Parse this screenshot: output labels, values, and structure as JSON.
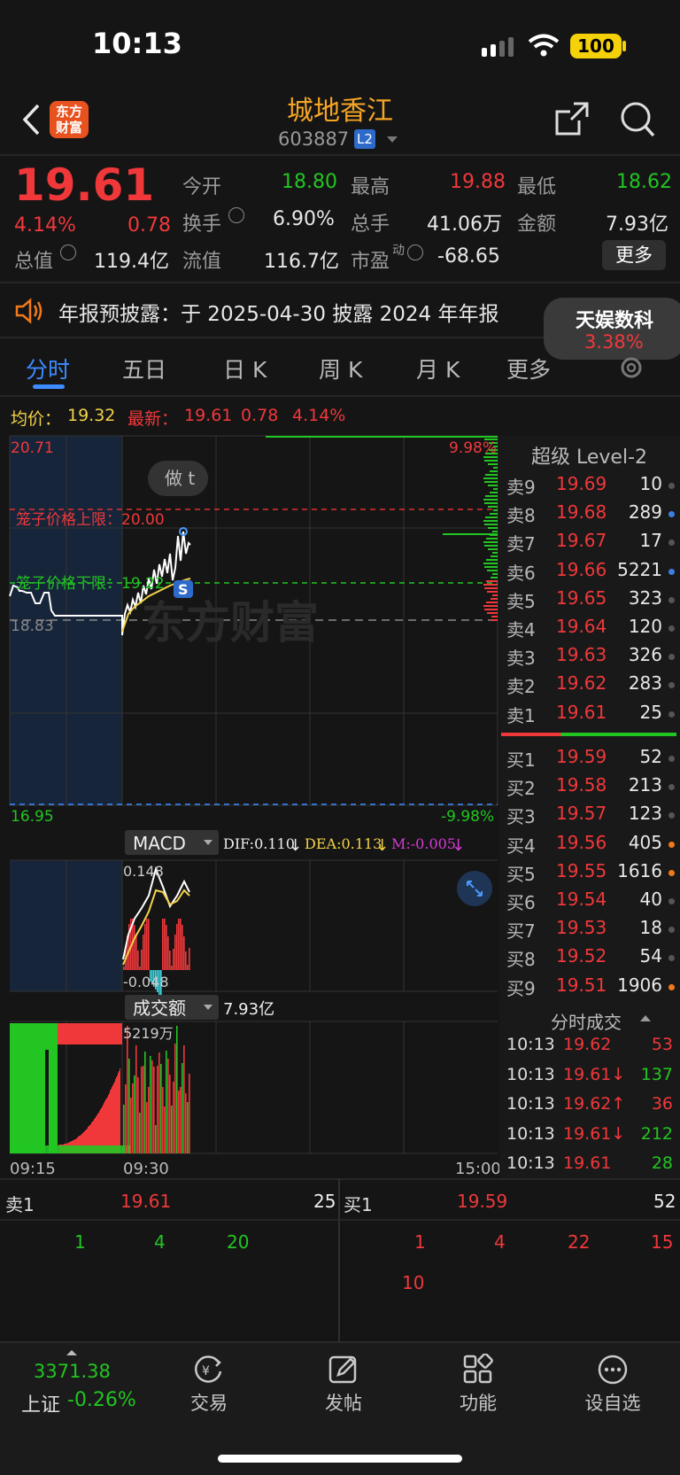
{
  "status_bar": {
    "time": "10:13",
    "battery": "100"
  },
  "header": {
    "logo": "东方财富",
    "title": "城地香江",
    "code": "603887",
    "level_badge": "L2"
  },
  "quote": {
    "price": "19.61",
    "change_pct": "4.14%",
    "change": "0.78",
    "open_label": "今开",
    "open": "18.80",
    "high_label": "最高",
    "high": "19.88",
    "low_label": "最低",
    "low": "18.62",
    "turnover_label": "换手",
    "turnover": "6.90%",
    "volume_label": "总手",
    "volume": "41.06万",
    "amount_label": "金额",
    "amount": "7.93亿",
    "mktcap_label": "总值",
    "mktcap": "119.4亿",
    "float_label": "流值",
    "float": "116.7亿",
    "pe_label": "市盈",
    "pe_sup": "动",
    "pe": "-68.65",
    "more_button": "更多"
  },
  "notice": {
    "text": "年报预披露：于 2025-04-30 披露 2024 年年报"
  },
  "hot_card": {
    "name": "天娱数科",
    "pct": "3.38%"
  },
  "tabs": [
    "分时",
    "五日",
    "日 K",
    "周 K",
    "月 K",
    "更多"
  ],
  "chart": {
    "avg_label": "均价：",
    "avg": "19.32",
    "latest_label": "最新：",
    "latest": "19.61",
    "latest_chg": "0.78",
    "latest_pct": "4.14%",
    "y_top": "20.71",
    "y_mid": "18.83",
    "y_bottom": "16.95",
    "pct_top": "9.98%",
    "pct_bottom": "-9.98%",
    "upper_limit": "笼子价格上限：20.00",
    "lower_limit": "笼子价格下限：19.22",
    "zuo_t": "做 t",
    "watermark": "东方财富",
    "macd_label": "MACD",
    "dif": "DIF:0.110",
    "dea": "DEA:0.113",
    "m": "M:-0.005",
    "macd_top": "0.148",
    "macd_bottom": "-0.048",
    "amount_label": "成交额",
    "amount_value": "7.93亿",
    "amount_peak": "5219万",
    "time_start": "09:15",
    "time_open": "09:30",
    "time_end": "15:00",
    "colors": {
      "up": "#f0383b",
      "down": "#22c522",
      "price_line": "#ffffff",
      "avg_line": "#f2d24a"
    }
  },
  "order_book": {
    "title": "超级 Level-2",
    "asks": [
      {
        "label": "卖9",
        "price": "19.69",
        "vol": "10",
        "dot": "#555555"
      },
      {
        "label": "卖8",
        "price": "19.68",
        "vol": "289",
        "dot": "#3d7fe0"
      },
      {
        "label": "卖7",
        "price": "19.67",
        "vol": "17",
        "dot": "#555555"
      },
      {
        "label": "卖6",
        "price": "19.66",
        "vol": "5221",
        "dot": "#3d7fe0"
      },
      {
        "label": "卖5",
        "price": "19.65",
        "vol": "323",
        "dot": "#555555"
      },
      {
        "label": "卖4",
        "price": "19.64",
        "vol": "120",
        "dot": "#555555"
      },
      {
        "label": "卖3",
        "price": "19.63",
        "vol": "326",
        "dot": "#555555"
      },
      {
        "label": "卖2",
        "price": "19.62",
        "vol": "283",
        "dot": "#555555"
      },
      {
        "label": "卖1",
        "price": "19.61",
        "vol": "25",
        "dot": "#555555"
      }
    ],
    "bids": [
      {
        "label": "买1",
        "price": "19.59",
        "vol": "52",
        "dot": "#555555"
      },
      {
        "label": "买2",
        "price": "19.58",
        "vol": "213",
        "dot": "#555555"
      },
      {
        "label": "买3",
        "price": "19.57",
        "vol": "123",
        "dot": "#555555"
      },
      {
        "label": "买4",
        "price": "19.56",
        "vol": "405",
        "dot": "#f07a1a"
      },
      {
        "label": "买5",
        "price": "19.55",
        "vol": "1616",
        "dot": "#f07a1a"
      },
      {
        "label": "买6",
        "price": "19.54",
        "vol": "40",
        "dot": "#555555"
      },
      {
        "label": "买7",
        "price": "19.53",
        "vol": "18",
        "dot": "#555555"
      },
      {
        "label": "买8",
        "price": "19.52",
        "vol": "54",
        "dot": "#555555"
      },
      {
        "label": "买9",
        "price": "19.51",
        "vol": "1906",
        "dot": "#f07a1a"
      }
    ]
  },
  "trades": {
    "title": "分时成交",
    "rows": [
      {
        "time": "10:13",
        "price": "19.62",
        "arrow": "",
        "vol": "53",
        "vcolor": "#f0383b"
      },
      {
        "time": "10:13",
        "price": "19.61",
        "arrow": "↓",
        "vol": "137",
        "vcolor": "#22c522"
      },
      {
        "time": "10:13",
        "price": "19.62",
        "arrow": "↑",
        "vol": "36",
        "vcolor": "#f0383b"
      },
      {
        "time": "10:13",
        "price": "19.61",
        "arrow": "↓",
        "vol": "212",
        "vcolor": "#22c522"
      },
      {
        "time": "10:13",
        "price": "19.61",
        "arrow": "",
        "vol": "28",
        "vcolor": "#22c522"
      }
    ]
  },
  "queue": {
    "ask_label": "卖1",
    "ask_price": "19.61",
    "ask_vol": "25",
    "bid_label": "买1",
    "bid_price": "19.59",
    "bid_vol": "52",
    "ask_orders": [
      "1",
      "4",
      "20"
    ],
    "bid_orders": [
      "1",
      "4",
      "22",
      "15",
      "10"
    ]
  },
  "bottom_nav": {
    "index_value": "3371.38",
    "index_name": "上证",
    "index_pct": "-0.26%",
    "items": [
      "交易",
      "发帖",
      "功能",
      "设自选"
    ]
  }
}
